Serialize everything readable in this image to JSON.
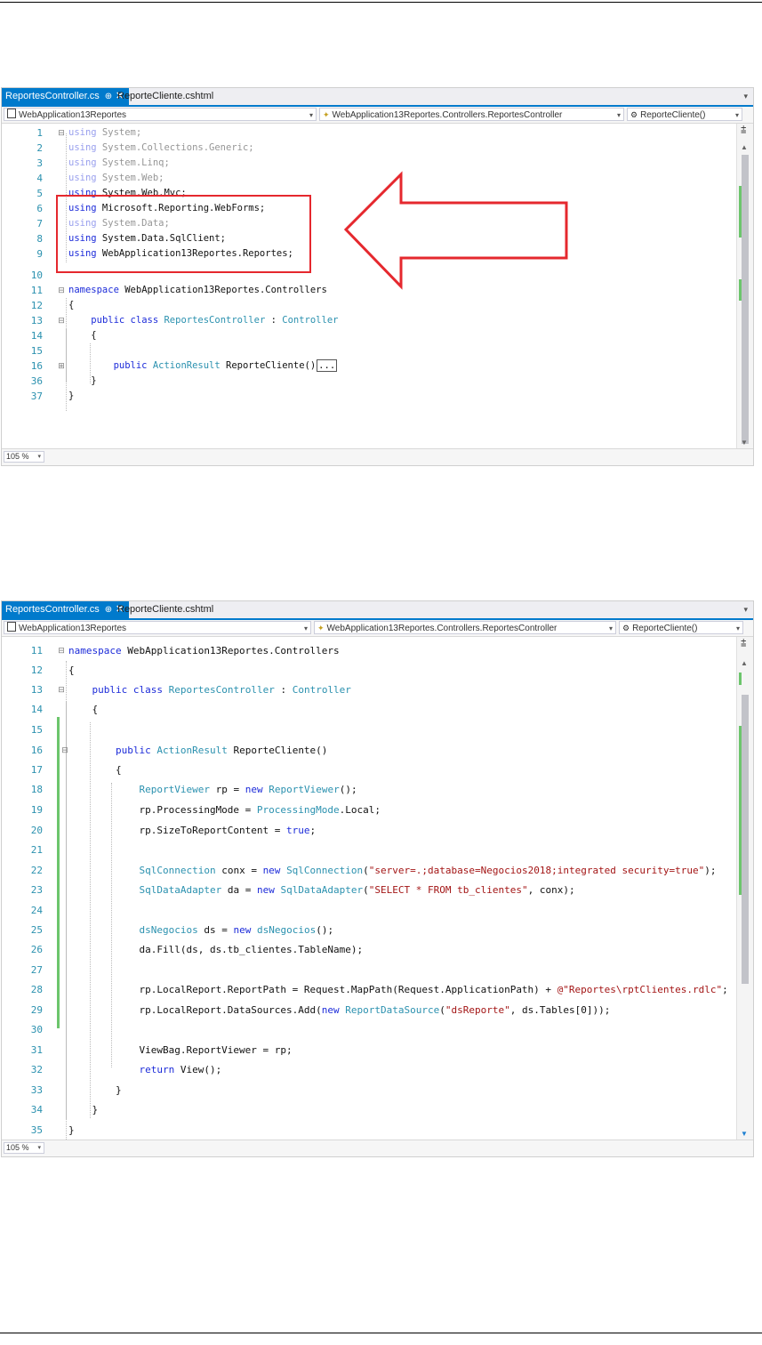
{
  "screenshots": [
    {
      "tabs": {
        "active": "ReportesController.cs",
        "inactive": "ReporteCliente.cshtml"
      },
      "navigation": {
        "project": "WebApplication13Reportes",
        "class": "WebApplication13Reportes.Controllers.ReportesController",
        "member": "ReporteCliente()"
      },
      "zoom": "105 %",
      "lines": [
        {
          "n": "1",
          "text": "using System;"
        },
        {
          "n": "2",
          "text": "using System.Collections.Generic;"
        },
        {
          "n": "3",
          "text": "using System.Linq;"
        },
        {
          "n": "4",
          "text": "using System.Web;"
        },
        {
          "n": "5",
          "text": "using System.Web.Mvc;"
        },
        {
          "n": "6",
          "text": "using Microsoft.Reporting.WebForms;"
        },
        {
          "n": "7",
          "text": "using System.Data;"
        },
        {
          "n": "8",
          "text": "using System.Data.SqlClient;"
        },
        {
          "n": "9",
          "text": "using WebApplication13Reportes.Reportes;"
        },
        {
          "n": "10",
          "text": ""
        },
        {
          "n": "11",
          "text": "namespace WebApplication13Reportes.Controllers"
        },
        {
          "n": "12",
          "text": "{"
        },
        {
          "n": "13",
          "text": "    public class ReportesController : Controller"
        },
        {
          "n": "14",
          "text": "    {"
        },
        {
          "n": "15",
          "text": ""
        },
        {
          "n": "16",
          "text": "        public ActionResult ReporteCliente()"
        },
        {
          "n": "36",
          "text": "    }"
        },
        {
          "n": "37",
          "text": "}"
        }
      ],
      "collapsed_marker": "..."
    },
    {
      "tabs": {
        "active": "ReportesController.cs",
        "inactive": "ReporteCliente.cshtml"
      },
      "navigation": {
        "project": "WebApplication13Reportes",
        "class": "WebApplication13Reportes.Controllers.ReportesController",
        "member": "ReporteCliente()"
      },
      "zoom": "105 %",
      "lines": [
        {
          "n": "11",
          "text": "namespace WebApplication13Reportes.Controllers"
        },
        {
          "n": "12",
          "text": "{"
        },
        {
          "n": "13",
          "text": "    public class ReportesController : Controller"
        },
        {
          "n": "14",
          "text": "    {"
        },
        {
          "n": "15",
          "text": ""
        },
        {
          "n": "16",
          "text": "        public ActionResult ReporteCliente()"
        },
        {
          "n": "17",
          "text": "        {"
        },
        {
          "n": "18",
          "text": "            ReportViewer rp = new ReportViewer();"
        },
        {
          "n": "19",
          "text": "            rp.ProcessingMode = ProcessingMode.Local;"
        },
        {
          "n": "20",
          "text": "            rp.SizeToReportContent = true;"
        },
        {
          "n": "21",
          "text": ""
        },
        {
          "n": "22",
          "text": "            SqlConnection conx = new SqlConnection(\"server=.;database=Negocios2018;integrated security=true\");"
        },
        {
          "n": "23",
          "text": "            SqlDataAdapter da = new SqlDataAdapter(\"SELECT * FROM tb_clientes\", conx);"
        },
        {
          "n": "24",
          "text": ""
        },
        {
          "n": "25",
          "text": "            dsNegocios ds = new dsNegocios();"
        },
        {
          "n": "26",
          "text": "            da.Fill(ds, ds.tb_clientes.TableName);"
        },
        {
          "n": "27",
          "text": ""
        },
        {
          "n": "28",
          "text": "            rp.LocalReport.ReportPath = Request.MapPath(Request.ApplicationPath) + @\"Reportes\\rptClientes.rdlc\";"
        },
        {
          "n": "29",
          "text": "            rp.LocalReport.DataSources.Add(new ReportDataSource(\"dsReporte\", ds.Tables[0]));"
        },
        {
          "n": "30",
          "text": ""
        },
        {
          "n": "31",
          "text": "            ViewBag.ReportViewer = rp;"
        },
        {
          "n": "32",
          "text": "            return View();"
        },
        {
          "n": "33",
          "text": "        }"
        },
        {
          "n": "34",
          "text": "    }"
        },
        {
          "n": "35",
          "text": "}"
        }
      ]
    }
  ],
  "colors": {
    "keyword": "#1c2bd9",
    "type": "#2b91af",
    "string": "#a31515",
    "line_number": "#2b91af",
    "tab_accent": "#007acc",
    "highlight": "#e5282e",
    "change_marker": "#6cc56c"
  },
  "icons": [
    "pin-icon",
    "close-icon",
    "project-icon",
    "class-icon",
    "method-icon",
    "dropdown-arrow-icon",
    "collapse-icon",
    "expand-icon",
    "split-icon",
    "scroll-up-icon",
    "scroll-down-icon",
    "arrow-left-icon"
  ]
}
